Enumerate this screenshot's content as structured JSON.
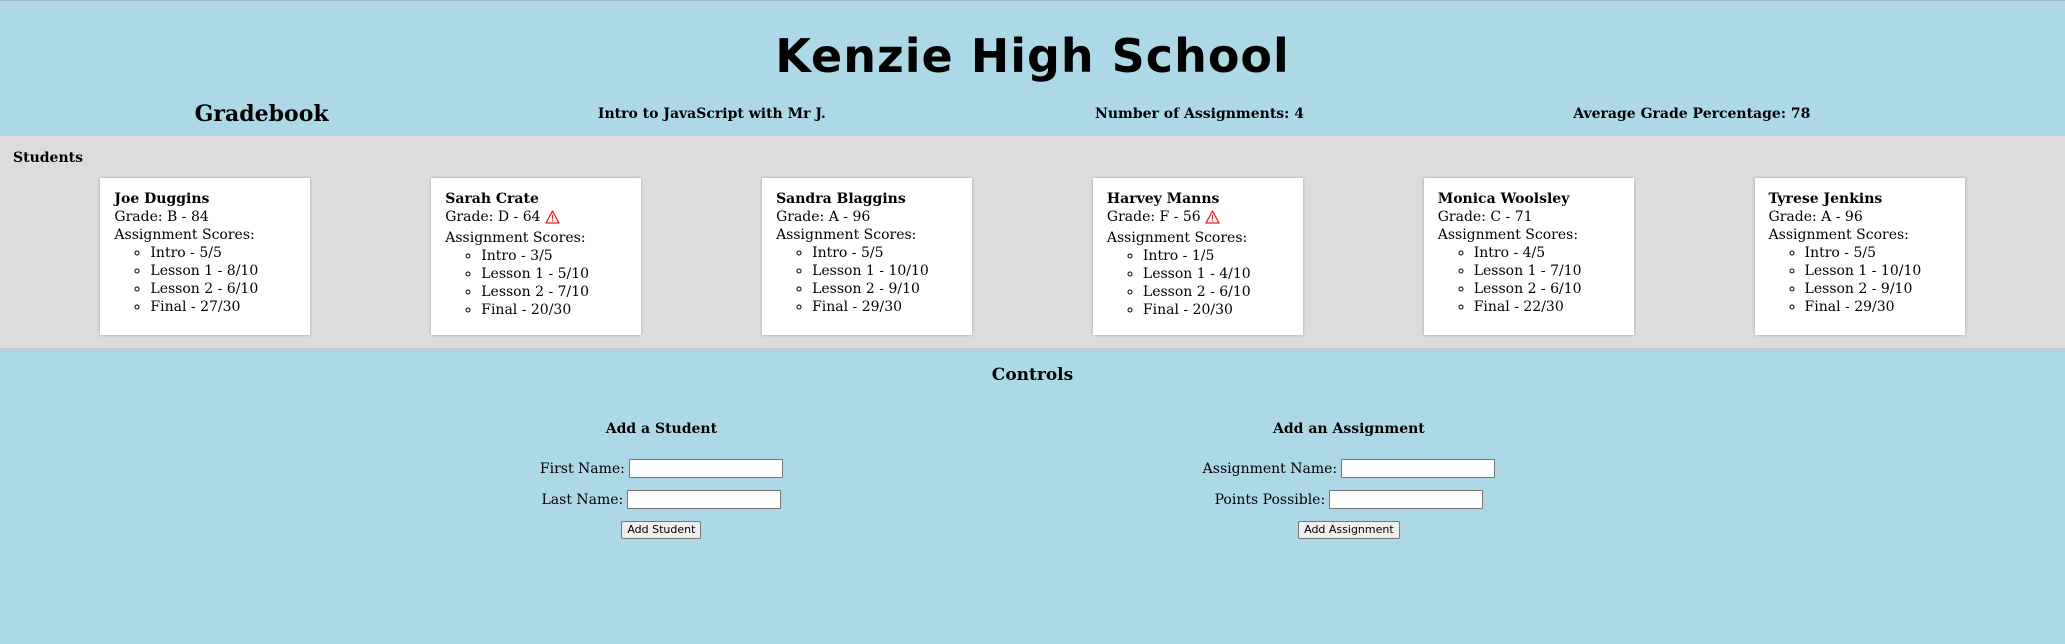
{
  "header": {
    "school_name": "Kenzie High School",
    "gradebook_label": "Gradebook",
    "course": "Intro to JavaScript with Mr J.",
    "assignments_count": "Number of Assignments: 4",
    "average_grade": "Average Grade Percentage: 78"
  },
  "students_section": {
    "heading": "Students",
    "scores_label": "Assignment Scores:",
    "students": [
      {
        "name": "Joe Duggins",
        "grade": "Grade: B - 84",
        "warning": false,
        "scores": [
          "Intro - 5/5",
          "Lesson 1 - 8/10",
          "Lesson 2 - 6/10",
          "Final - 27/30"
        ]
      },
      {
        "name": "Sarah Crate",
        "grade": "Grade: D - 64",
        "warning": true,
        "scores": [
          "Intro - 3/5",
          "Lesson 1 - 5/10",
          "Lesson 2 - 7/10",
          "Final - 20/30"
        ]
      },
      {
        "name": "Sandra Blaggins",
        "grade": "Grade: A - 96",
        "warning": false,
        "scores": [
          "Intro - 5/5",
          "Lesson 1 - 10/10",
          "Lesson 2 - 9/10",
          "Final - 29/30"
        ]
      },
      {
        "name": "Harvey Manns",
        "grade": "Grade: F - 56",
        "warning": true,
        "scores": [
          "Intro - 1/5",
          "Lesson 1 - 4/10",
          "Lesson 2 - 6/10",
          "Final - 20/30"
        ]
      },
      {
        "name": "Monica Woolsley",
        "grade": "Grade: C - 71",
        "warning": false,
        "scores": [
          "Intro - 4/5",
          "Lesson 1 - 7/10",
          "Lesson 2 - 6/10",
          "Final - 22/30"
        ]
      },
      {
        "name": "Tyrese Jenkins",
        "grade": "Grade: A - 96",
        "warning": false,
        "scores": [
          "Intro - 5/5",
          "Lesson 1 - 10/10",
          "Lesson 2 - 9/10",
          "Final - 29/30"
        ]
      }
    ]
  },
  "controls": {
    "title": "Controls",
    "add_student": {
      "heading": "Add a Student",
      "first_name_label": "First Name:",
      "first_name_value": "",
      "last_name_label": "Last Name:",
      "last_name_value": "",
      "button_label": "Add Student"
    },
    "add_assignment": {
      "heading": "Add an Assignment",
      "assignment_name_label": "Assignment Name:",
      "assignment_name_value": "",
      "points_label": "Points Possible:",
      "points_value": "",
      "button_label": "Add Assignment"
    }
  },
  "icons": {
    "warning": "warning-icon"
  },
  "colors": {
    "background": "#add8e6",
    "panel": "#dcdcdc",
    "warning": "#e0202a"
  }
}
